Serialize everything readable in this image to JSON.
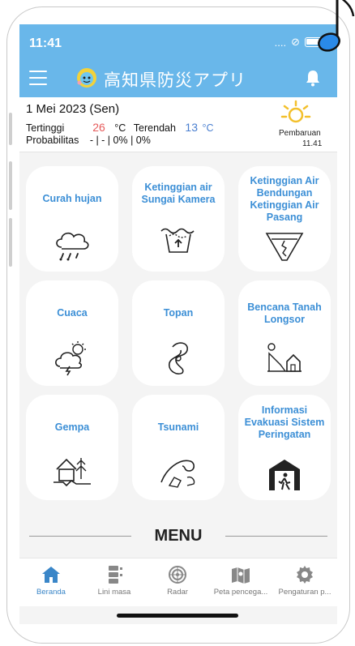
{
  "status": {
    "time": "11:41",
    "signal": "....",
    "link_glyph": "⊘"
  },
  "app": {
    "title": "高知県防災アプリ"
  },
  "weather": {
    "date": "1 Mei 2023 (Sen)",
    "high_label": "Tertinggi",
    "high_value": "26",
    "high_unit": "°C",
    "low_label": "Terendah",
    "low_value": "13",
    "low_unit": "°C",
    "prob_label": "Probabilitas",
    "prob_value": "- | - | 0% | 0%",
    "update_label": "Pembaruan",
    "update_time": "11.41"
  },
  "tiles": [
    {
      "label": "Curah hujan",
      "icon": "rain-cloud-icon"
    },
    {
      "label": "Ketinggian air Sungai Kamera",
      "icon": "river-level-icon"
    },
    {
      "label": "Ketinggian Air Bendungan Ketinggian Air Pasang",
      "icon": "dam-level-icon"
    },
    {
      "label": "Cuaca",
      "icon": "weather-storm-icon"
    },
    {
      "label": "Topan",
      "icon": "typhoon-icon"
    },
    {
      "label": "Bencana Tanah Longsor",
      "icon": "landslide-icon"
    },
    {
      "label": "Gempa",
      "icon": "earthquake-icon"
    },
    {
      "label": "Tsunami",
      "icon": "tsunami-icon"
    },
    {
      "label": "Informasi Evakuasi Sistem Peringatan",
      "icon": "evacuation-icon"
    }
  ],
  "menu": {
    "heading": "MENU"
  },
  "nav": [
    {
      "label": "Beranda",
      "icon": "home-icon",
      "active": true
    },
    {
      "label": "Lini masa",
      "icon": "timeline-icon"
    },
    {
      "label": "Radar",
      "icon": "radar-icon"
    },
    {
      "label": "Peta pencega...",
      "icon": "map-icon"
    },
    {
      "label": "Pengaturan p...",
      "icon": "gear-icon"
    }
  ],
  "colors": {
    "accent": "#69b7ea",
    "tile_text": "#3c8fd6",
    "high": "#e65b5b",
    "low": "#4a7fd0"
  }
}
